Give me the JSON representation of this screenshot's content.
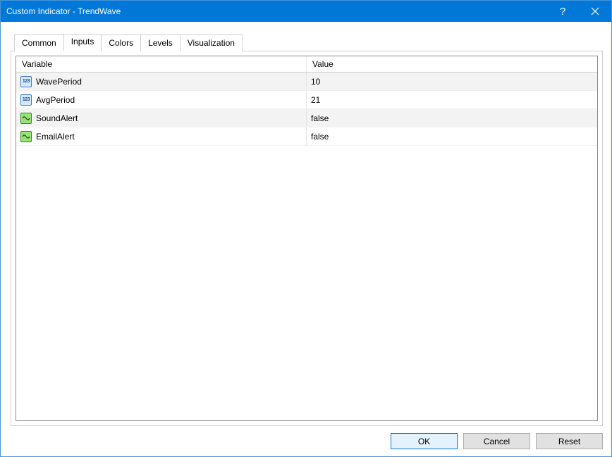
{
  "window": {
    "title": "Custom Indicator - TrendWave",
    "help_glyph": "?",
    "close_label": "Close"
  },
  "tabs": {
    "common": "Common",
    "inputs": "Inputs",
    "colors": "Colors",
    "levels": "Levels",
    "visualization": "Visualization",
    "active": "inputs"
  },
  "grid": {
    "header_variable": "Variable",
    "header_value": "Value",
    "rows": [
      {
        "icon": "int",
        "name": "WavePeriod",
        "value": "10"
      },
      {
        "icon": "int",
        "name": "AvgPeriod",
        "value": "21"
      },
      {
        "icon": "bool",
        "name": "SoundAlert",
        "value": "false"
      },
      {
        "icon": "bool",
        "name": "EmailAlert",
        "value": "false"
      }
    ]
  },
  "buttons": {
    "ok": "OK",
    "cancel": "Cancel",
    "reset": "Reset"
  }
}
